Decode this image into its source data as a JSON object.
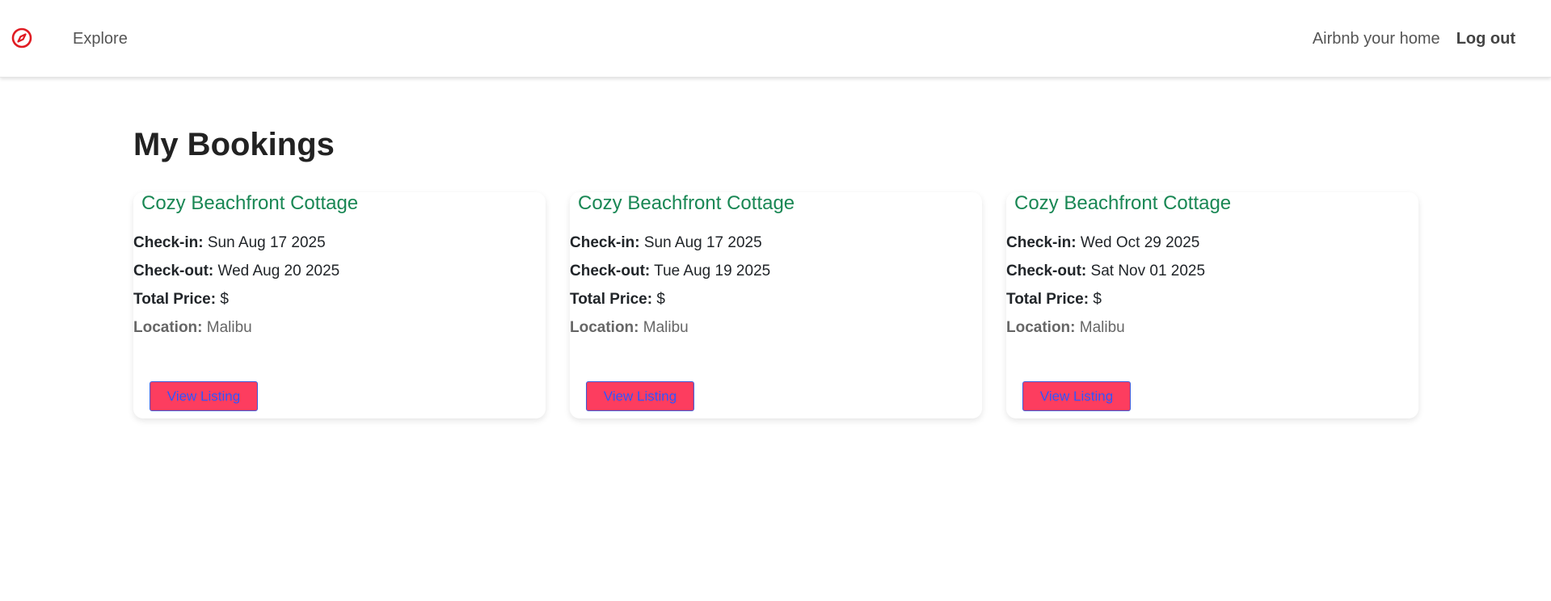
{
  "nav": {
    "explore_label": "Explore",
    "host_label": "Airbnb your home",
    "logout_label": "Log out"
  },
  "page": {
    "title": "My Bookings"
  },
  "labels": {
    "checkin": "Check-in:",
    "checkout": "Check-out:",
    "total_price": "Total Price:",
    "location": "Location:"
  },
  "bookings": [
    {
      "title": "Cozy Beachfront Cottage",
      "checkin": "Sun Aug 17 2025",
      "checkout": "Wed Aug 20 2025",
      "price": "$",
      "location": "Malibu",
      "button_label": "View Listing"
    },
    {
      "title": "Cozy Beachfront Cottage",
      "checkin": "Sun Aug 17 2025",
      "checkout": "Tue Aug 19 2025",
      "price": "$",
      "location": "Malibu",
      "button_label": "View Listing"
    },
    {
      "title": "Cozy Beachfront Cottage",
      "checkin": "Wed Oct 29 2025",
      "checkout": "Sat Nov 01 2025",
      "price": "$",
      "location": "Malibu",
      "button_label": "View Listing"
    }
  ],
  "colors": {
    "brand": "#e01b22",
    "card_title": "#198754",
    "button_bg": "#fd3d5f",
    "button_text": "#2f55ff"
  },
  "icons": {
    "brand": "compass-icon"
  }
}
